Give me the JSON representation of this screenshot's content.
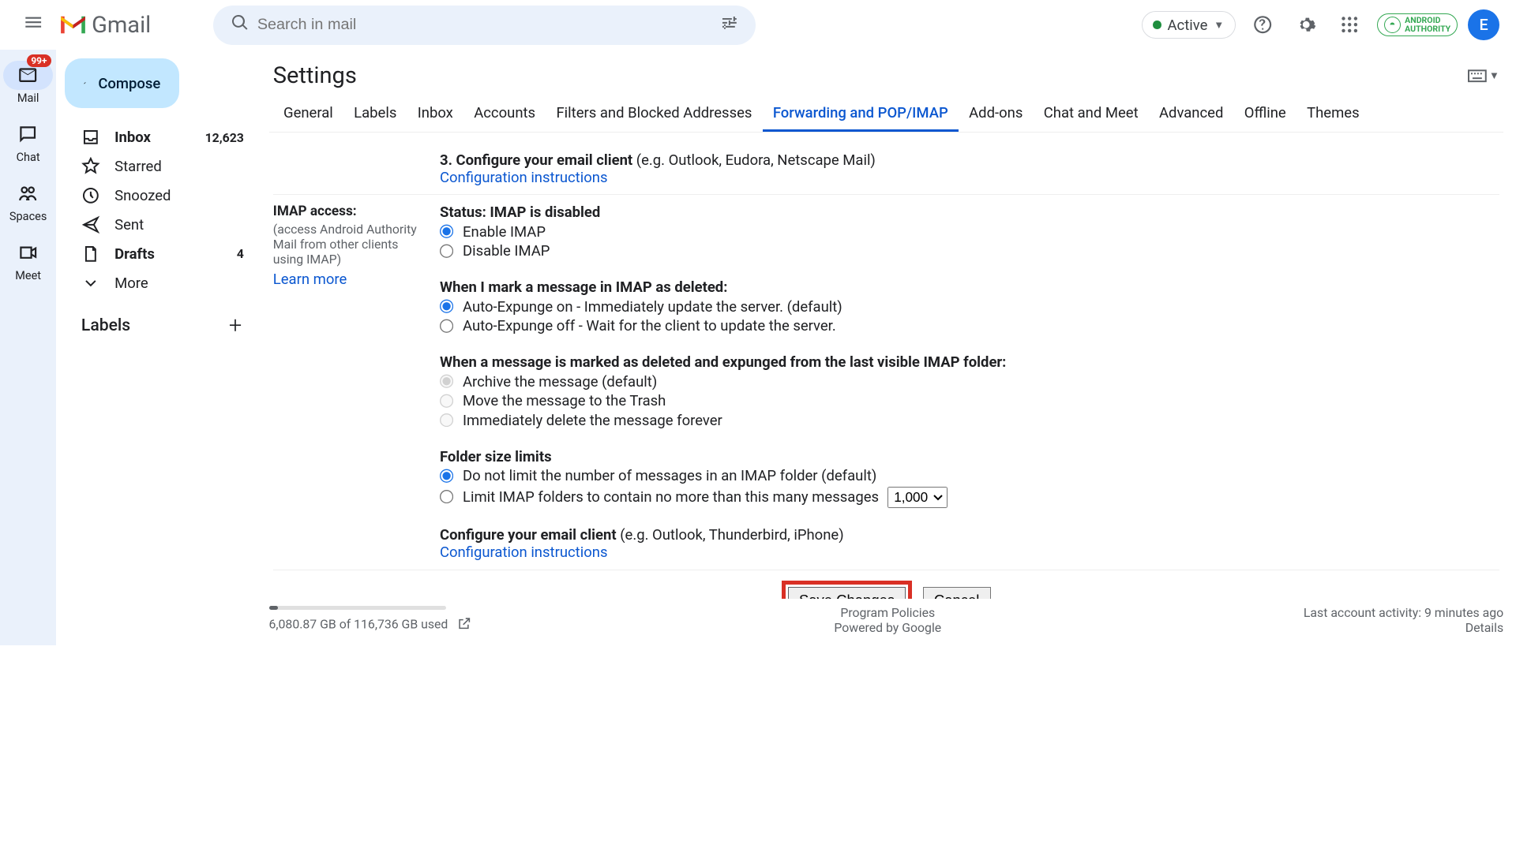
{
  "app": {
    "name": "Gmail"
  },
  "search": {
    "placeholder": "Search in mail"
  },
  "status": {
    "label": "Active"
  },
  "avatar": {
    "letter": "E"
  },
  "brand_badge": {
    "line1": "ANDROID",
    "line2": "AUTHORITY"
  },
  "rail": [
    {
      "label": "Mail",
      "badge": "99+"
    },
    {
      "label": "Chat"
    },
    {
      "label": "Spaces"
    },
    {
      "label": "Meet"
    }
  ],
  "compose": "Compose",
  "nav": [
    {
      "label": "Inbox",
      "count": "12,623",
      "bold": true,
      "icon": "inbox"
    },
    {
      "label": "Starred",
      "icon": "star"
    },
    {
      "label": "Snoozed",
      "icon": "clock"
    },
    {
      "label": "Sent",
      "icon": "send"
    },
    {
      "label": "Drafts",
      "count": "4",
      "bold": true,
      "icon": "draft"
    },
    {
      "label": "More",
      "icon": "expand"
    }
  ],
  "labels_header": "Labels",
  "settings": {
    "title": "Settings",
    "tabs": [
      "General",
      "Labels",
      "Inbox",
      "Accounts",
      "Filters and Blocked Addresses",
      "Forwarding and POP/IMAP",
      "Add-ons",
      "Chat and Meet",
      "Advanced",
      "Offline",
      "Themes"
    ],
    "active_tab": "Forwarding and POP/IMAP",
    "pop_config": {
      "step": "3. Configure your email client",
      "hint": "(e.g. Outlook, Eudora, Netscape Mail)",
      "link": "Configuration instructions"
    },
    "imap": {
      "label": "IMAP access:",
      "sublabel": "(access Android Authority Mail from other clients using IMAP)",
      "learn": "Learn more",
      "status_label": "Status: IMAP is disabled",
      "enable": "Enable IMAP",
      "disable": "Disable IMAP",
      "deleted_header": "When I mark a message in IMAP as deleted:",
      "expunge_on": "Auto-Expunge on - Immediately update the server. (default)",
      "expunge_off": "Auto-Expunge off - Wait for the client to update the server.",
      "expunged_header": "When a message is marked as deleted and expunged from the last visible IMAP folder:",
      "archive": "Archive the message (default)",
      "trash": "Move the message to the Trash",
      "delete": "Immediately delete the message forever",
      "folder_header": "Folder size limits",
      "nolimit": "Do not limit the number of messages in an IMAP folder (default)",
      "limit": "Limit IMAP folders to contain no more than this many messages",
      "limit_value": "1,000",
      "config_label": "Configure your email client",
      "config_hint": "(e.g. Outlook, Thunderbird, iPhone)",
      "config_link": "Configuration instructions"
    },
    "save": "Save Changes",
    "cancel": "Cancel"
  },
  "footer": {
    "storage": "6,080.87 GB of 116,736 GB used",
    "policies": "Program Policies",
    "powered": "Powered by Google",
    "activity": "Last account activity: 9 minutes ago",
    "details": "Details"
  }
}
